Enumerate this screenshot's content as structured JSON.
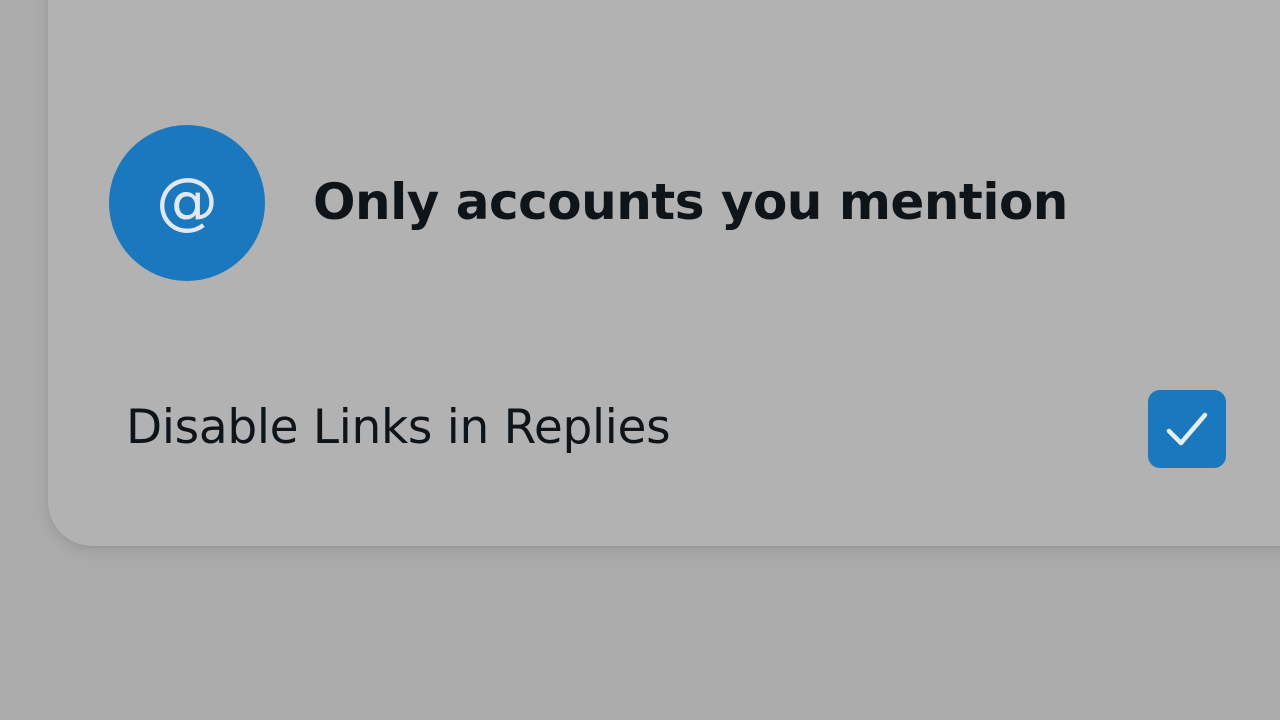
{
  "audience_options": [
    {
      "label": "",
      "icon": "avatar-circle"
    },
    {
      "label": "Only accounts you mention",
      "icon": "at-sign-icon",
      "icon_glyph": "@"
    }
  ],
  "settings": {
    "disable_links": {
      "label": "Disable Links in Replies",
      "checked": true,
      "icon": "checkmark-icon"
    }
  },
  "colors": {
    "backdrop": "#ababab",
    "card": "#b2b2b2",
    "accent": "#1a78be",
    "text": "#0f1419",
    "icon_fg": "#e3e8ee"
  }
}
